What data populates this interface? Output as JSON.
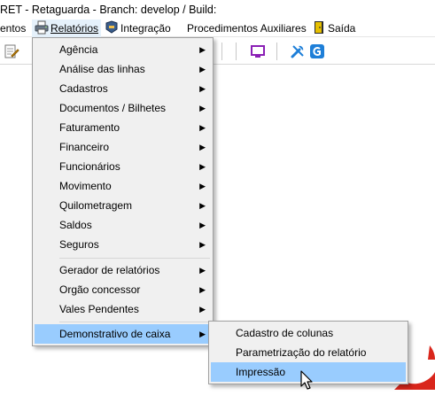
{
  "window": {
    "title": "RET - Retaguarda - Branch: develop / Build:"
  },
  "menubar": {
    "items": [
      {
        "label": "entos"
      },
      {
        "label": "Relatórios"
      },
      {
        "label": "Integração"
      },
      {
        "label": "Procedimentos Auxiliares"
      },
      {
        "label": "Saída"
      }
    ]
  },
  "toolbar": {
    "icons": [
      "edit-document-icon",
      "monitor-icon",
      "tools-icon",
      "g-app-icon"
    ]
  },
  "relatorios_menu": {
    "groups": [
      [
        {
          "label": "Agência",
          "has_submenu": true
        },
        {
          "label": "Análise das linhas",
          "has_submenu": true
        },
        {
          "label": "Cadastros",
          "has_submenu": true
        },
        {
          "label": "Documentos / Bilhetes",
          "has_submenu": true
        },
        {
          "label": "Faturamento",
          "has_submenu": true
        },
        {
          "label": "Financeiro",
          "has_submenu": true
        },
        {
          "label": "Funcionários",
          "has_submenu": true
        },
        {
          "label": "Movimento",
          "has_submenu": true
        },
        {
          "label": "Quilometragem",
          "has_submenu": true
        },
        {
          "label": "Saldos",
          "has_submenu": true
        },
        {
          "label": "Seguros",
          "has_submenu": true
        }
      ],
      [
        {
          "label": "Gerador de relatórios",
          "has_submenu": true
        },
        {
          "label": "Orgão concessor",
          "has_submenu": true
        },
        {
          "label": "Vales Pendentes",
          "has_submenu": true
        }
      ],
      [
        {
          "label": "Demonstrativo de caixa",
          "has_submenu": true,
          "highlighted": true
        }
      ]
    ]
  },
  "demonstrativo_submenu": {
    "items": [
      {
        "label": "Cadastro de colunas"
      },
      {
        "label": "Parametrização do relatório"
      },
      {
        "label": "Impressão",
        "highlighted": true
      }
    ]
  },
  "colors": {
    "highlight": "#99ccfe",
    "menu_bg": "#f0f0f0",
    "menu_border": "#a0a0a0",
    "monitor_icon": "#8a1fb5",
    "tools_icon": "#1e7fd8",
    "logo_red": "#d9261c"
  }
}
